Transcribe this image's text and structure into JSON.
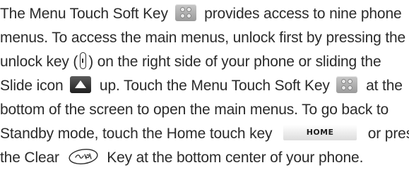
{
  "document": {
    "lines": [
      {
        "before": "The Menu Touch Soft Key",
        "after": "provides access to nine phone"
      },
      {
        "text": "menus. To access the main menus, unlock first by pressing the"
      },
      {
        "before": "unlock key (",
        "after": ") on the right side of your phone or sliding the"
      },
      {
        "before": "Slide icon",
        "after": "up. Touch the Menu Touch Soft Key",
        "after2": "at the"
      },
      {
        "text": "bottom of the screen to open the main menus. To go back to"
      },
      {
        "before": "Standby mode, touch the Home touch key",
        "after": "or press"
      },
      {
        "before": "the Clear",
        "after": "Key at the bottom center of your phone."
      }
    ],
    "home_key_label": "HOME"
  },
  "icons": {
    "menu": "menu-soft-key-icon",
    "unlock": "unlock-key-icon",
    "slide": "slide-icon",
    "home": "home-touch-key",
    "clear": "clear-key-icon"
  }
}
